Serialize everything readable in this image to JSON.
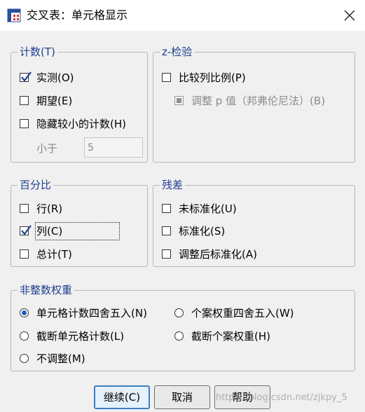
{
  "window": {
    "title": "交叉表：单元格显示"
  },
  "groups": {
    "counts": {
      "label": "计数(T)",
      "observed": "实测(O)",
      "expected": "期望(E)",
      "hide_small": "隐藏较小的计数(H)",
      "less_than_label": "小于",
      "less_than_value": "5"
    },
    "ztest": {
      "label": "z-检验",
      "compare_col": "比较列比例(P)",
      "adjust_p": "调整 p 值（邦弗伦尼法）(B)"
    },
    "percentages": {
      "label": "百分比",
      "row": "行(R)",
      "column": "列(C)",
      "total": "总计(T)"
    },
    "residuals": {
      "label": "残差",
      "unstandardized": "未标准化(U)",
      "standardized": "标准化(S)",
      "adjusted_standardized": "调整后标准化(A)"
    },
    "noninteger": {
      "label": "非整数权重",
      "round_cell": "单元格计数四舍五入(N)",
      "round_case": "个案权重四舍五入(W)",
      "truncate_cell": "截断单元格计数(L)",
      "truncate_case": "截断个案权重(H)",
      "no_adjust": "不调整(M)"
    }
  },
  "state": {
    "observed": true,
    "expected": false,
    "hide_small": false,
    "compare_col": false,
    "adjust_p": false,
    "row": false,
    "column": true,
    "total": false,
    "unstandardized": false,
    "standardized": false,
    "adjusted_standardized": false,
    "weights_selected": "round_cell"
  },
  "buttons": {
    "continue": "继续(C)",
    "cancel": "取消",
    "help": "帮助"
  },
  "watermark": "https://blog.csdn.net/zjkpy_5",
  "colors": {
    "group_label": "#1e3e8f",
    "focus_border": "#3e7dc4"
  }
}
